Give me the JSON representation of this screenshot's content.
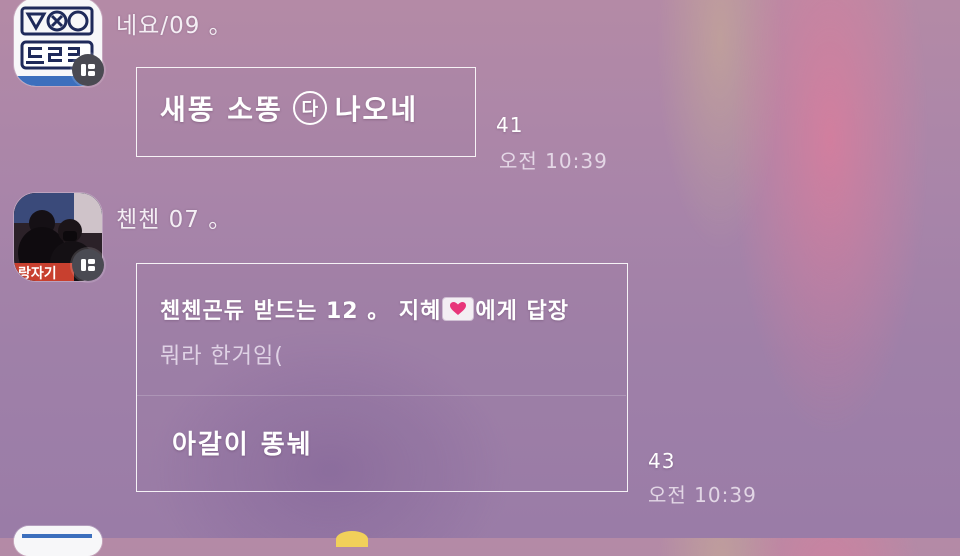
{
  "messages": [
    {
      "sender": "네요/09 。",
      "avatar": "exo-logo-avatar",
      "text_before": "새똥 소똥",
      "circled": "다",
      "text_after": "나오네",
      "read_count": "41",
      "time": "오전 10:39"
    },
    {
      "sender": "첸첸 07 。",
      "avatar": "photo-avatar",
      "reply_to_prefix": "첸첸곤듀 받드는 12 。 지혜",
      "reply_to_suffix": "에게 답장",
      "quoted_text": "뭐라 한거임(",
      "text": "아갈이 똥눼",
      "read_count": "43",
      "time": "오전 10:39"
    }
  ],
  "icons": {
    "badge": "menu-badge-icon",
    "heart_mail": "heart-envelope-icon"
  },
  "colors": {
    "bubble_border": "#ffffff",
    "badge_bg": "#4a4a52",
    "background": "#a985a9",
    "rainbow": "#f07896"
  }
}
